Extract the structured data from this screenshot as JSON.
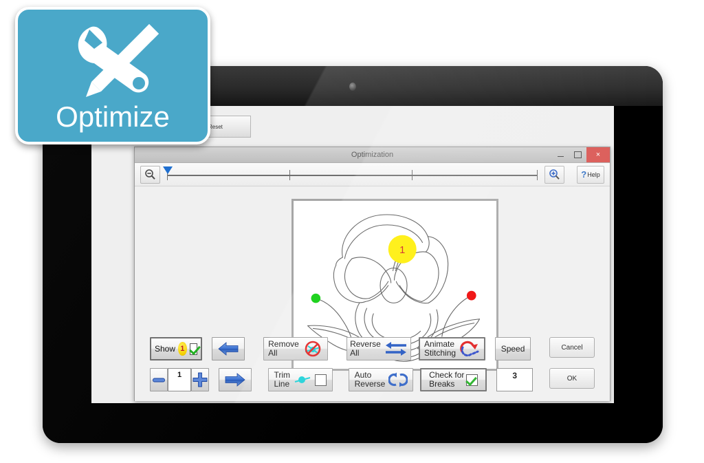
{
  "badge": {
    "label": "Optimize",
    "icon": "wrench-pencil-icon",
    "bg_color": "#4aa8c9",
    "border_color": "#ffffff"
  },
  "window": {
    "title": "Optimization",
    "controls": {
      "minimize": "–",
      "maximize": "□",
      "close": "×",
      "close_color": "#d9534f"
    }
  },
  "toolbar": {
    "zoom_out_icon": "zoom-out-icon",
    "zoom_in_icon": "zoom-in-icon",
    "help_label": "Help",
    "help_symbol": "?",
    "slider": {
      "value": 0,
      "min": 0,
      "max": 100,
      "ticks": 4,
      "handle_color": "#1f6fd0"
    }
  },
  "behind_toolbar": {
    "label": "Reset"
  },
  "canvas": {
    "design": "flower-pansy-outline",
    "start_point_color": "#00cc00",
    "end_point_color": "#ee0000",
    "marker_label": "1",
    "marker_color": "#ffee00",
    "marker_text_color": "#cc2020",
    "line_color": "#555555"
  },
  "controls": {
    "show_label": "Show",
    "show_count": "1",
    "show_checked": true,
    "prev_label": "",
    "next_label": "",
    "minus_label": "",
    "plus_label": "",
    "segment_value": "1",
    "remove_all_line1": "Remove",
    "remove_all_line2": "All",
    "trim_line_line1": "Trim",
    "trim_line_line2": "Line",
    "trim_line_checked": false,
    "reverse_all_line1": "Reverse",
    "reverse_all_line2": "All",
    "auto_reverse_line1": "Auto",
    "auto_reverse_line2": "Reverse",
    "animate_line1": "Animate",
    "animate_line2": "Stitching",
    "animate_pressed": true,
    "speed_label": "Speed",
    "speed_value": "3",
    "check_breaks_line1": "Check for",
    "check_breaks_line2": "Breaks",
    "check_breaks_checked": true,
    "check_breaks_pressed": true,
    "cancel_label": "Cancel",
    "ok_label": "OK"
  }
}
